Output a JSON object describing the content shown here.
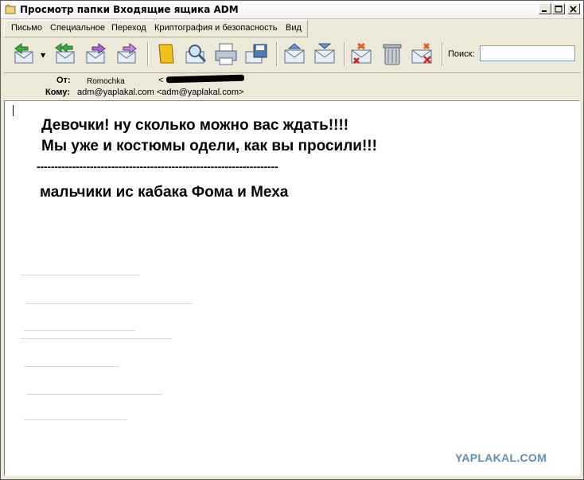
{
  "window": {
    "title": "Просмотр папки Входящие ящика ADM"
  },
  "menu": {
    "items": [
      "Письмо",
      "Специальное",
      "Переход",
      "Криптография и безопасность",
      "Вид"
    ]
  },
  "toolbar": {
    "icons": [
      "reply-icon",
      "reply-all-icon",
      "forward-icon",
      "forward-as-attachment-icon",
      "address-book-icon",
      "find-icon",
      "print-icon",
      "save-icon",
      "previous-icon",
      "next-icon",
      "mark-deleted-icon",
      "trash-icon",
      "delete-icon"
    ],
    "search_label": "Поиск:",
    "search_value": ""
  },
  "header": {
    "from_label": "От:",
    "from_name": "Romochka",
    "from_bracket": "<",
    "to_label": "Кому:",
    "to_value": "adm@yaplakal.com <adm@yaplakal.com>"
  },
  "message": {
    "line1": "Девочки! ну сколько можно вас ждать!!!!",
    "line2": "Мы уже и костюмы одели, как вы просили!!!",
    "separator": "--------------------------------------------------------------------",
    "signature": "мальчики ис кабака Фома и Меха"
  },
  "watermark": "YAPLAKAL.COM",
  "colors": {
    "window_bg": "#ece9d8",
    "watermark": "#5d8fb8"
  }
}
